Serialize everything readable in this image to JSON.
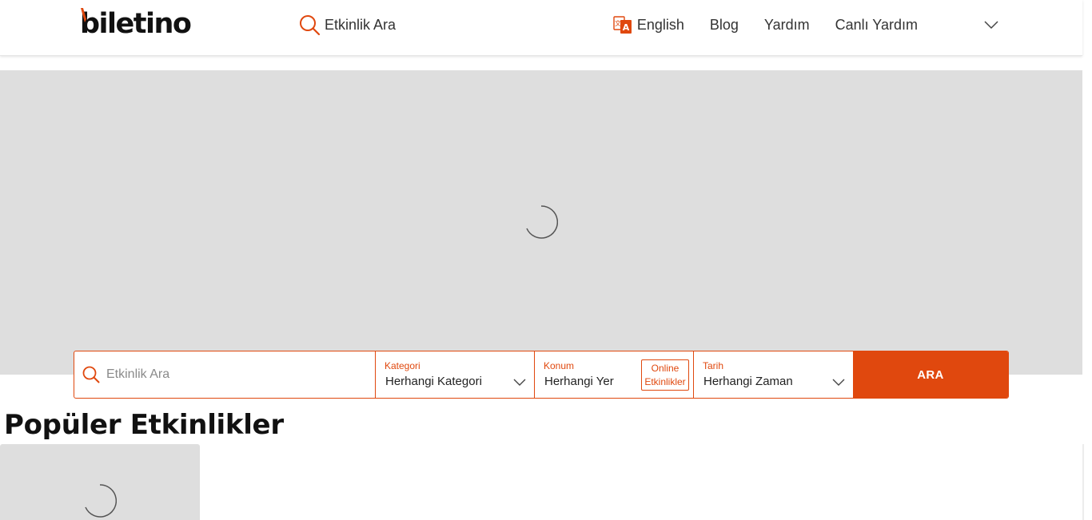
{
  "header": {
    "logo_text": "biletino",
    "search_label": "Etkinlik Ara",
    "nav": {
      "language": "English",
      "blog": "Blog",
      "help": "Yardım",
      "live_help": "Canlı Yardım"
    }
  },
  "search_bar": {
    "placeholder": "Etkinlik Ara",
    "category": {
      "label": "Kategori",
      "value": "Herhangi Kategori"
    },
    "location": {
      "label": "Konum",
      "value": "Herhangi Yer",
      "online_line1": "Online",
      "online_line2": "Etkinlikler"
    },
    "date": {
      "label": "Tarih",
      "value": "Herhangi Zaman"
    },
    "button": "ARA"
  },
  "popular": {
    "title": "Popüler Etkinlikler"
  },
  "colors": {
    "accent": "#e0480e",
    "placeholder_bg": "#dedede"
  },
  "icons": [
    "search-icon",
    "translate-icon",
    "chevron-down-icon",
    "loading-spinner-icon"
  ]
}
